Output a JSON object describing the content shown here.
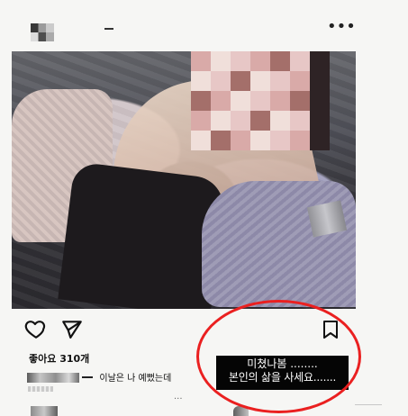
{
  "post": {
    "likes": "좋아요 310개",
    "caption": "이날은 나 예뻤는데",
    "more_icon": "•••"
  },
  "overlay": {
    "line1": "미쳤나봄 ........",
    "line2": "본인의 삶을 사세요......."
  },
  "icons": {
    "heart": "heart-icon",
    "send": "send-icon",
    "bookmark": "bookmark-icon"
  },
  "colors": {
    "annotation_circle": "#ea2020",
    "overlay_background": "#050505",
    "overlay_text": "#ffffff"
  }
}
